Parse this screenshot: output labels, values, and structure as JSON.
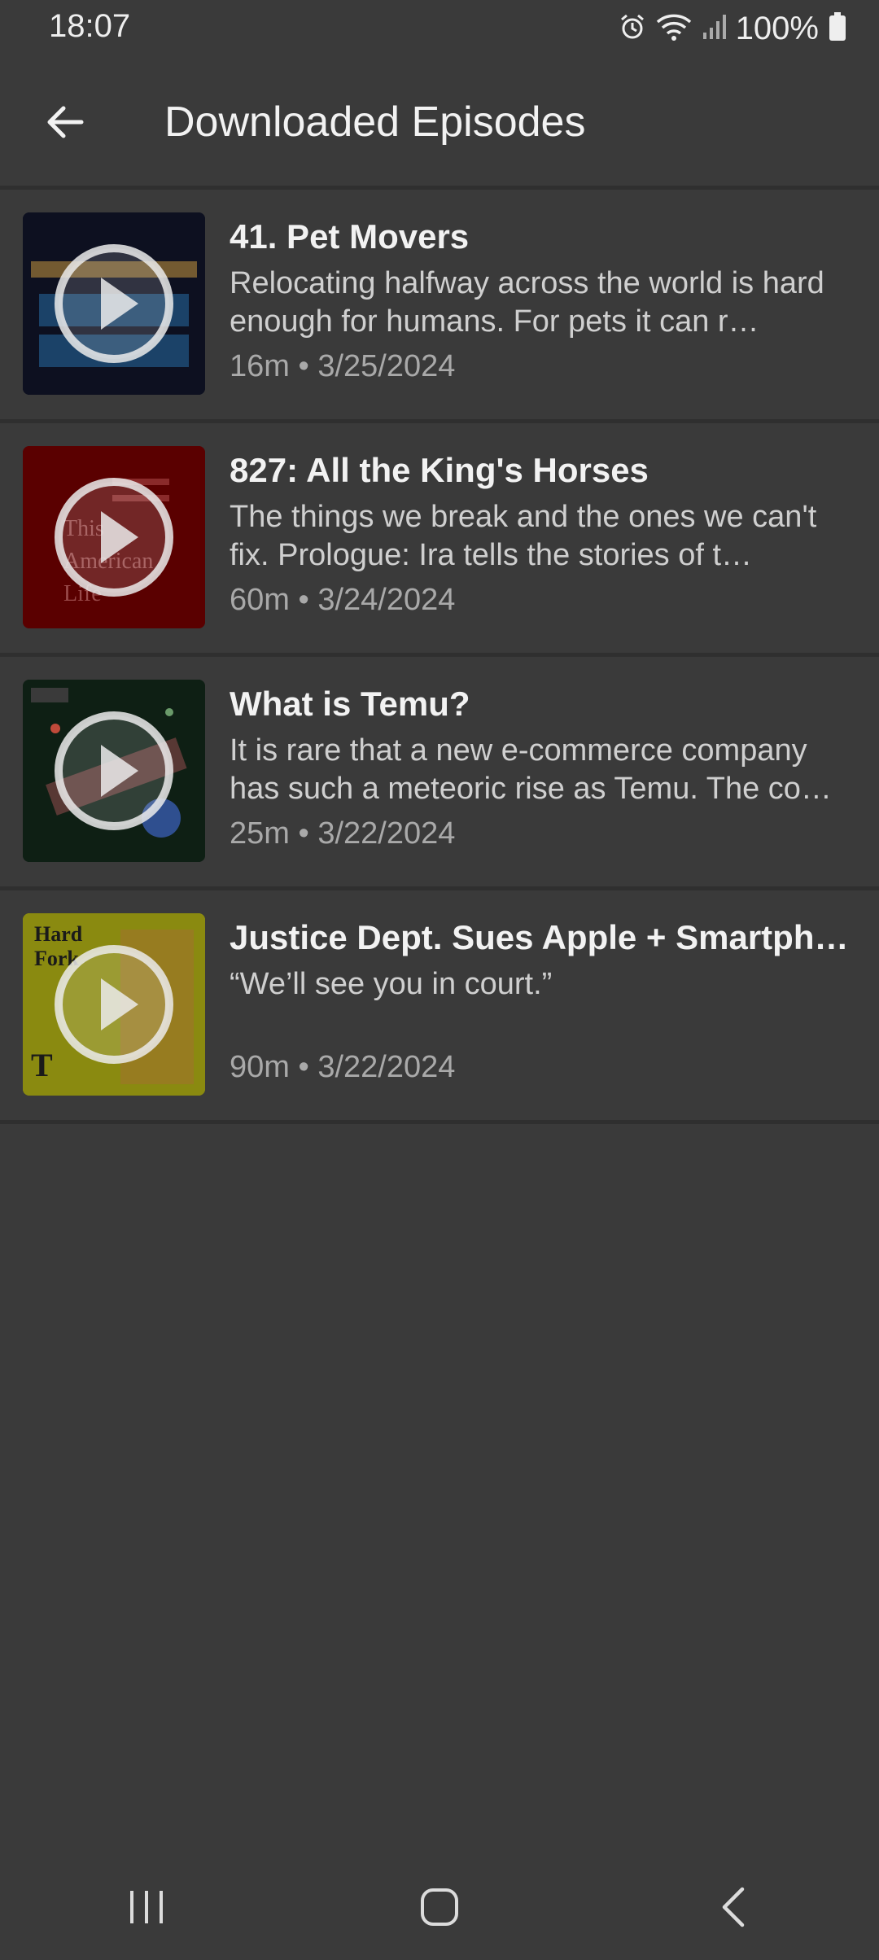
{
  "status": {
    "time": "18:07",
    "battery_text": "100%",
    "icons": [
      "alarm-icon",
      "wifi-icon",
      "signal-icon",
      "battery-icon"
    ]
  },
  "app_bar": {
    "title": "Downloaded Episodes",
    "back_icon": "arrow-left-icon"
  },
  "episodes": [
    {
      "title": "41. Pet Movers",
      "description": "Relocating halfway across the world is hard enough for humans. For pets it can r…",
      "meta": "16m • 3/25/2024",
      "art_colors": [
        "#0d1020",
        "#1f3b5a"
      ]
    },
    {
      "title": "827: All the King's Horses",
      "description": "The things we break and the ones we can't fix. Prologue: Ira tells the stories of t…",
      "meta": "60m • 3/24/2024",
      "art_colors": [
        "#5a0000",
        "#7a1010"
      ]
    },
    {
      "title": "What is Temu?",
      "description": "It is rare that a new e-commerce company has such a meteoric rise as Temu. The co…",
      "meta": "25m • 3/22/2024",
      "art_colors": [
        "#0e1f14",
        "#7a3a3a"
      ]
    },
    {
      "title": "Justice Dept. Sues Apple + Smartph…",
      "description": "“We’ll see you in court.”",
      "meta": "90m • 3/22/2024",
      "art_colors": [
        "#8a8a10",
        "#b0a020"
      ]
    }
  ],
  "nav": {
    "recents_icon": "recents-icon",
    "home_icon": "home-icon",
    "back_icon": "back-chevron-icon"
  },
  "colors": {
    "background": "#3a3a3a",
    "divider": "#2f2f2f",
    "title_text": "#f2f2f2",
    "meta_text": "#a9a9a9"
  }
}
